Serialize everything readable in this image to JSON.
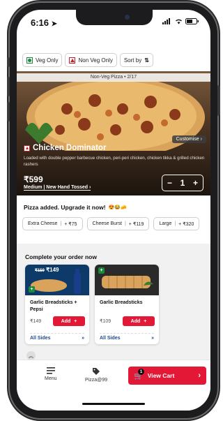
{
  "status": {
    "time": "6:16"
  },
  "filters": {
    "veg_label": "Veg Only",
    "nonveg_label": "Non Veg Only",
    "sort_label": "Sort by"
  },
  "hero": {
    "ribbon": "Non-Veg Pizza  •  2/17",
    "customise": "Customise",
    "title": "Chicken Dominator",
    "description": "Loaded with double pepper barbecue chicken, peri-peri chicken, chicken tikka & grilled chicken rashers",
    "price": "₹599",
    "size": "Medium | New Hand Tossed",
    "quantity": "1"
  },
  "upgrade": {
    "title": "Pizza added. Upgrade it now!",
    "emoji": "😍😂🧀",
    "options": [
      {
        "name": "Extra Cheese",
        "price": "+ ₹75"
      },
      {
        "name": "Cheese Burst",
        "price": "+ ₹119"
      },
      {
        "name": "Large",
        "price": "+ ₹320"
      }
    ]
  },
  "complete": {
    "title": "Complete your order now",
    "cards": [
      {
        "name": "Garlic Breadsticks + Pepsi",
        "price": "₹149",
        "old_price": "₹159",
        "deal_price": "₹149",
        "add_label": "Add",
        "sides_label": "All Sides"
      },
      {
        "name": "Garlic Breadsticks",
        "price": "₹109",
        "add_label": "Add",
        "sides_label": "All Sides"
      }
    ]
  },
  "nav": {
    "menu_label": "Menu",
    "pizza99_label": "Pizza@99",
    "cart_label": "View Cart",
    "cart_count": "1"
  },
  "colors": {
    "accent": "#e31837",
    "link_blue": "#1e4a8a",
    "veg_green": "#1a8a3a"
  }
}
